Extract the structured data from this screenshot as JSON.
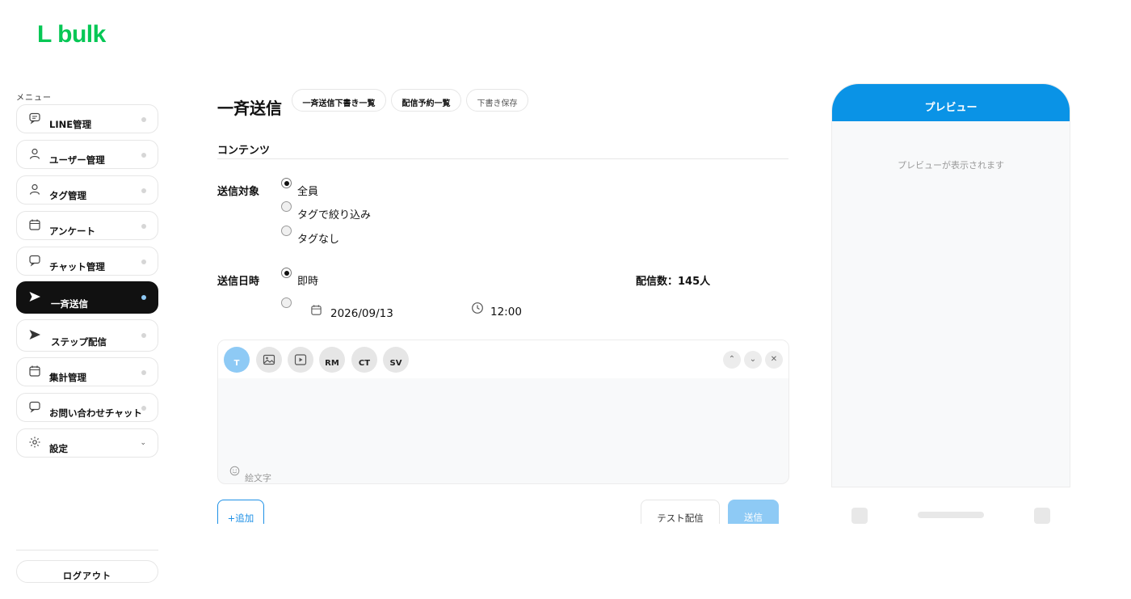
{
  "app": {
    "logo": "L bulk",
    "brand_color": "#06c755",
    "accent_color": "#0a93e6"
  },
  "sidebar": {
    "menu_label": "メニュー",
    "items": [
      {
        "label": "LINE管理",
        "icon": "chat-bubble-icon"
      },
      {
        "label": "ユーザー管理",
        "icon": "user-icon"
      },
      {
        "label": "タグ管理",
        "icon": "user-icon"
      },
      {
        "label": "アンケート",
        "icon": "calendar-icon"
      },
      {
        "label": "チャット管理",
        "icon": "chat-bubble-icon"
      },
      {
        "label": "一斉送信",
        "icon": "send-icon",
        "active": true
      },
      {
        "label": "ステップ配信",
        "icon": "send-icon"
      },
      {
        "label": "集計管理",
        "icon": "calendar-icon"
      },
      {
        "label": "お問い合わせチャット",
        "icon": "chat-bubble-icon"
      },
      {
        "label": "設定",
        "icon": "gear-icon",
        "expandable": true
      }
    ],
    "logout": "ログアウト"
  },
  "main": {
    "title": "一斉送信",
    "header_buttons": [
      "一斉送信下書き一覧",
      "配信予約一覧",
      "下書き保存"
    ],
    "section": "コンテンツ",
    "target": {
      "label": "送信対象",
      "options": [
        "全員",
        "タグで絞り込み",
        "タグなし"
      ],
      "selected": "全員"
    },
    "schedule": {
      "label": "送信日時",
      "immediate": "即時",
      "selected": "即時",
      "date": "2026/09/13",
      "time": "12:00"
    },
    "delivery_count": "配信数：145人",
    "editor": {
      "tools": [
        "T",
        "image-icon",
        "video-icon",
        "RM",
        "CT",
        "SV"
      ],
      "emoji_label": "絵文字"
    },
    "add_button": "+追加",
    "test_button": "テスト配信",
    "send_button": "送信"
  },
  "preview": {
    "title": "プレビュー",
    "empty": "プレビューが表示されます"
  }
}
